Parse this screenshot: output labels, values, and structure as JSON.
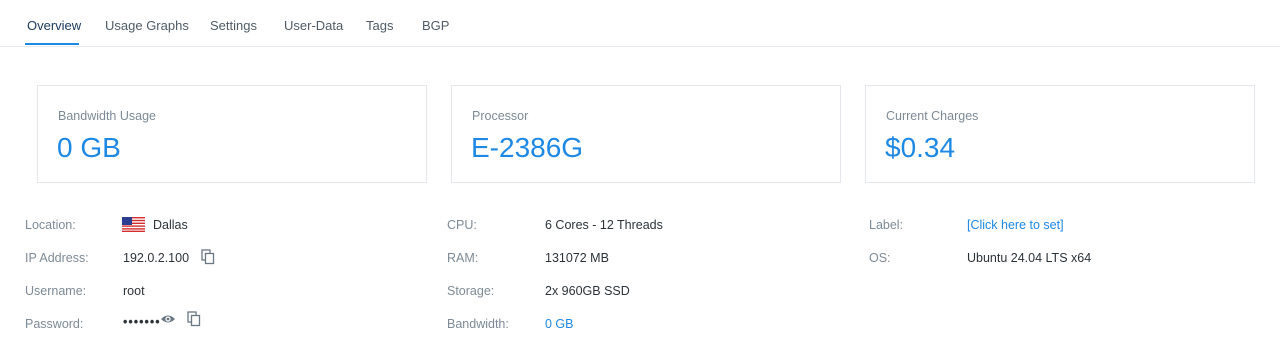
{
  "tabs": [
    {
      "label": "Overview",
      "active": true
    },
    {
      "label": "Usage Graphs"
    },
    {
      "label": "Settings"
    },
    {
      "label": "User-Data"
    },
    {
      "label": "Tags"
    },
    {
      "label": "BGP"
    }
  ],
  "cards": [
    {
      "label": "Bandwidth Usage",
      "value": "0 GB"
    },
    {
      "label": "Processor",
      "value": "E-2386G"
    },
    {
      "label": "Current Charges",
      "value": "$0.34"
    }
  ],
  "details": {
    "location": {
      "label": "Location:",
      "value": "Dallas",
      "flag": "us-flag-icon"
    },
    "ip": {
      "label": "IP Address:",
      "value": "192.0.2.100",
      "icon": "copy-icon"
    },
    "username": {
      "label": "Username:",
      "value": "root"
    },
    "password": {
      "label": "Password:",
      "value": "•••••••",
      "icons": [
        "eye-icon",
        "copy-icon"
      ]
    },
    "cpu": {
      "label": "CPU:",
      "value": "6 Cores - 12 Threads"
    },
    "ram": {
      "label": "RAM:",
      "value": "131072 MB"
    },
    "storage": {
      "label": "Storage:",
      "value": "2x 960GB SSD"
    },
    "bandwidth": {
      "label": "Bandwidth:",
      "value": "0 GB"
    },
    "server_label": {
      "label": "Label:",
      "value": "[Click here to set]"
    },
    "os": {
      "label": "OS:",
      "value": "Ubuntu 24.04 LTS x64"
    }
  },
  "colors": {
    "accent": "#1e88e5",
    "muted": "#7d8a96",
    "border": "#e3e7eb"
  }
}
